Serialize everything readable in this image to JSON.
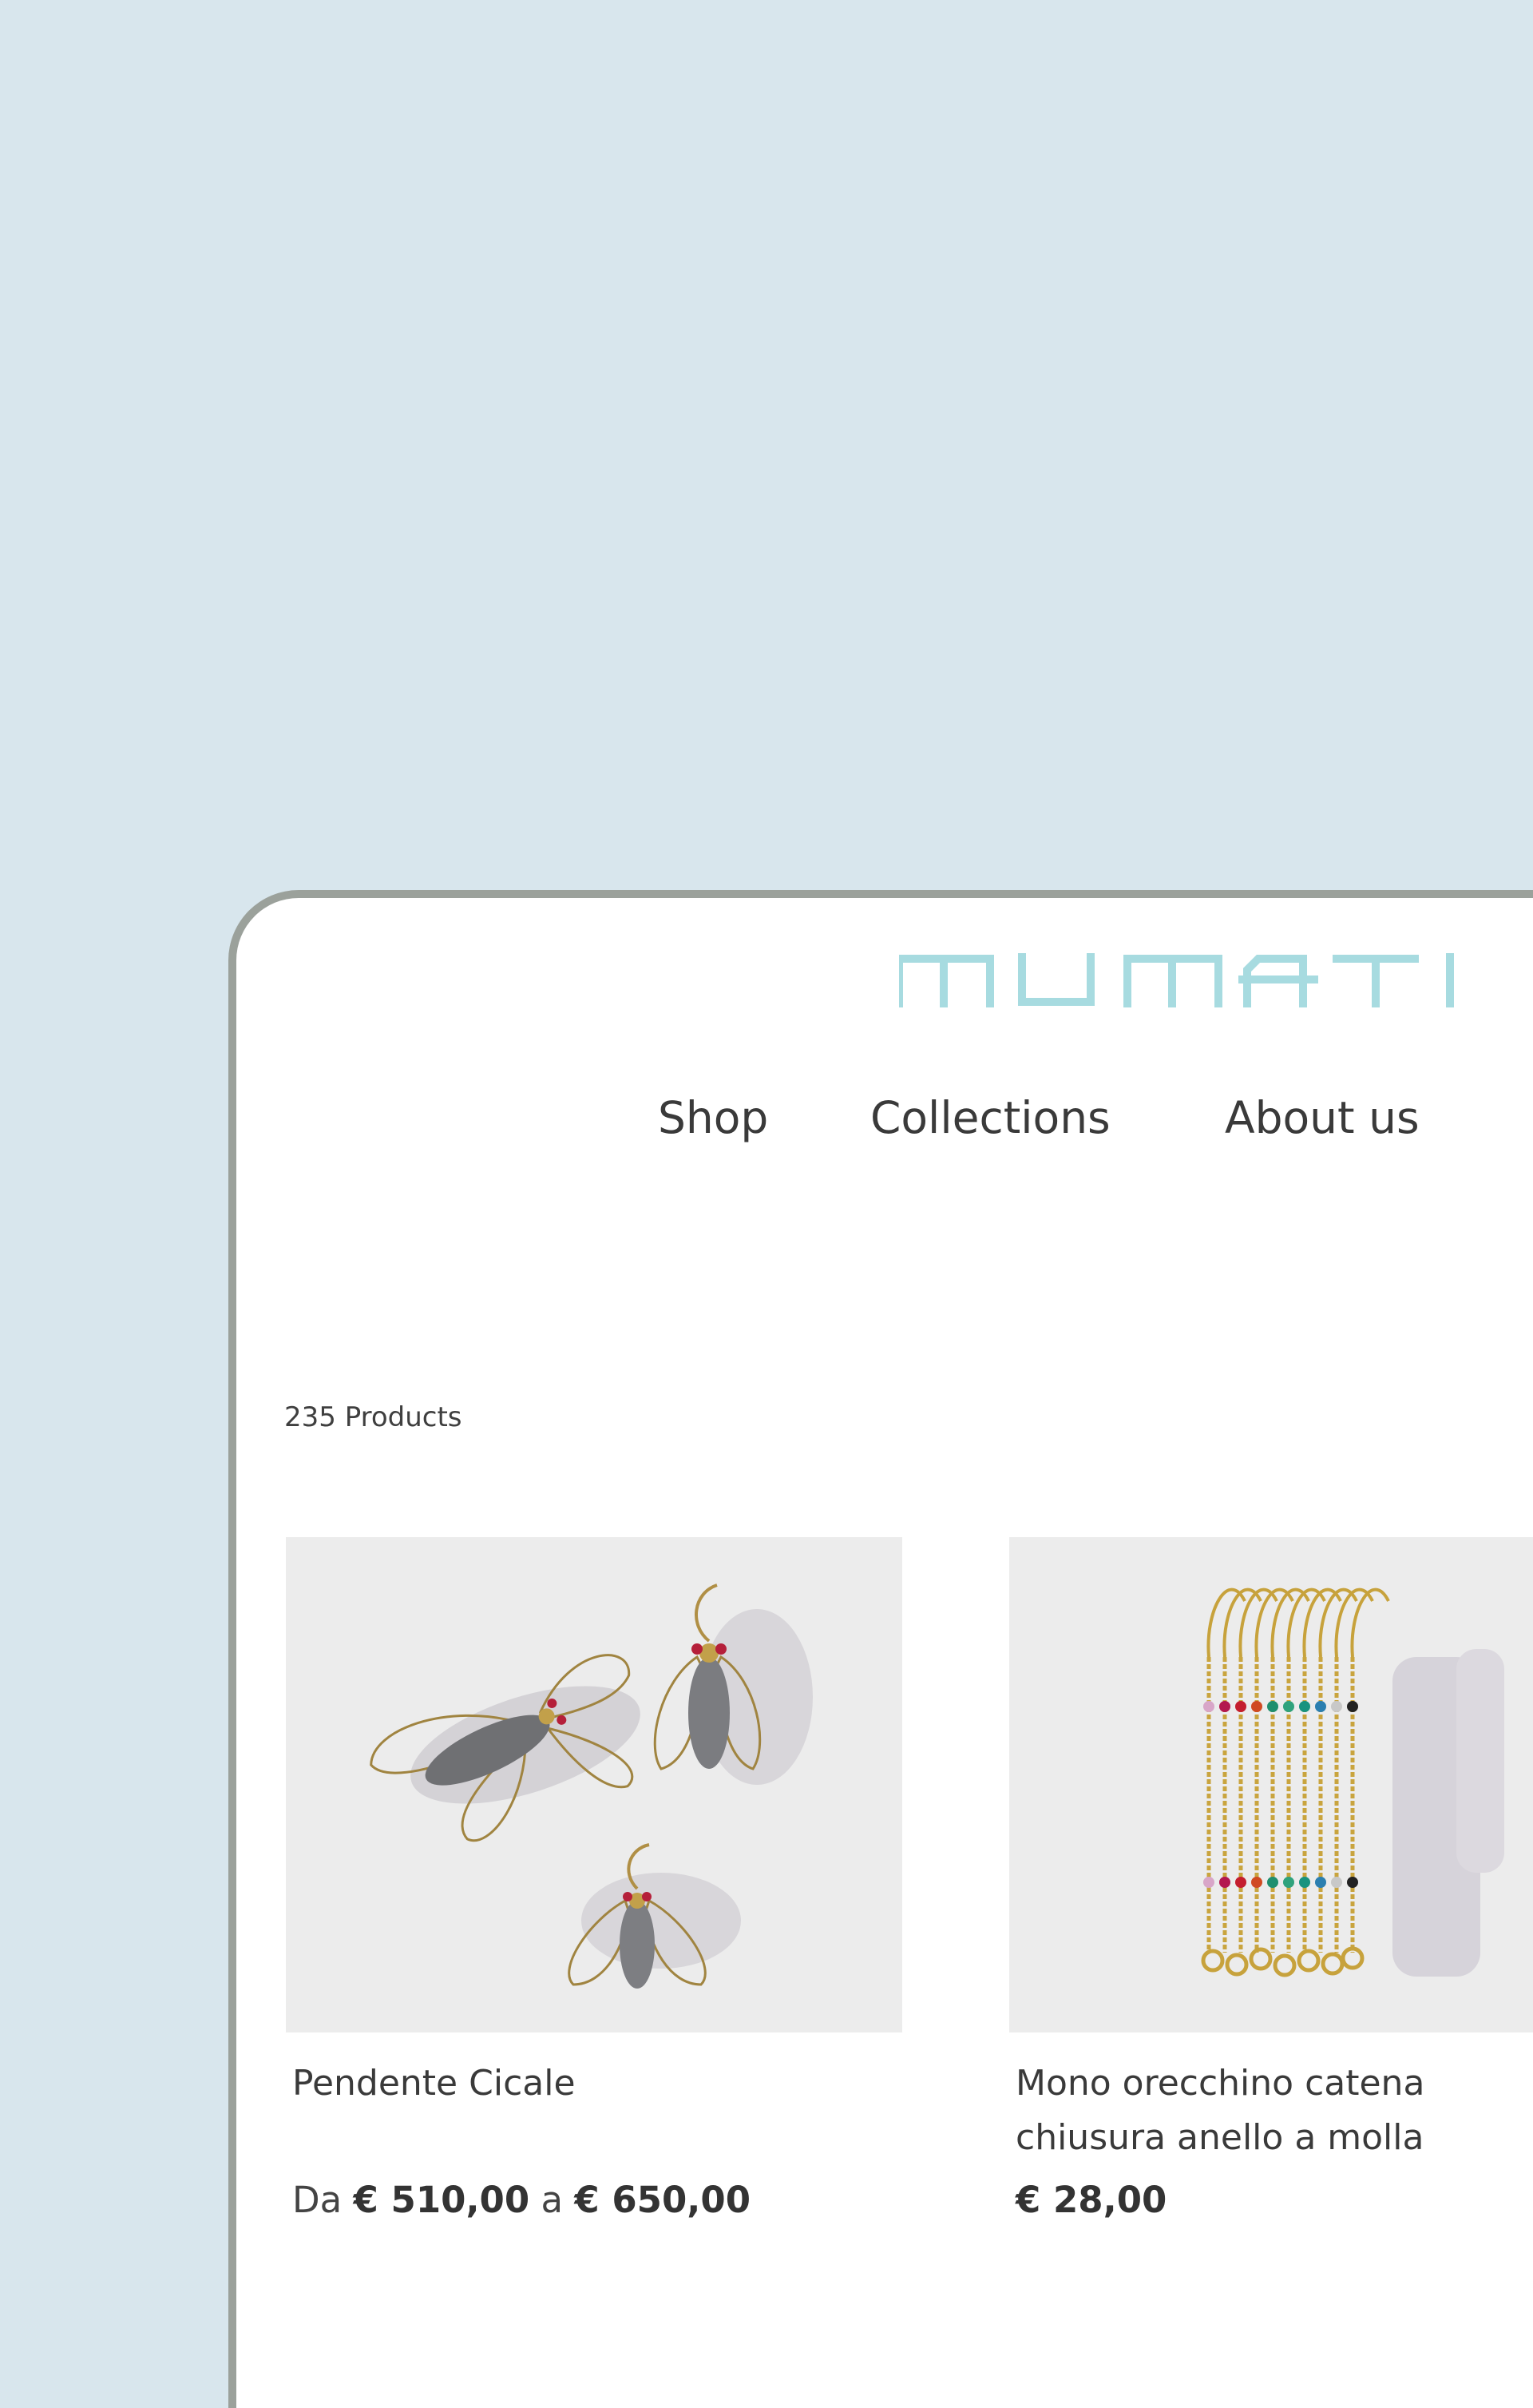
{
  "brand": {
    "logo_text": "MUMATI"
  },
  "nav": {
    "items": [
      "Shop",
      "Collections",
      "About us"
    ]
  },
  "catalog": {
    "count_label": "235 Products"
  },
  "products": [
    {
      "name": "Pendente Cicale",
      "price_prefix": "Da",
      "price_from": "€ 510,00",
      "price_sep": "a",
      "price_to": "€ 650,00"
    },
    {
      "name": "Mono orecchino catena chiusura anello a molla",
      "price": "€ 28,00"
    }
  ],
  "colors": {
    "background": "#d8e6ed",
    "frame": "#9ba19b",
    "logo": "#a7dbe0",
    "text": "#3a3a3a",
    "image_bg": "#ececec"
  }
}
